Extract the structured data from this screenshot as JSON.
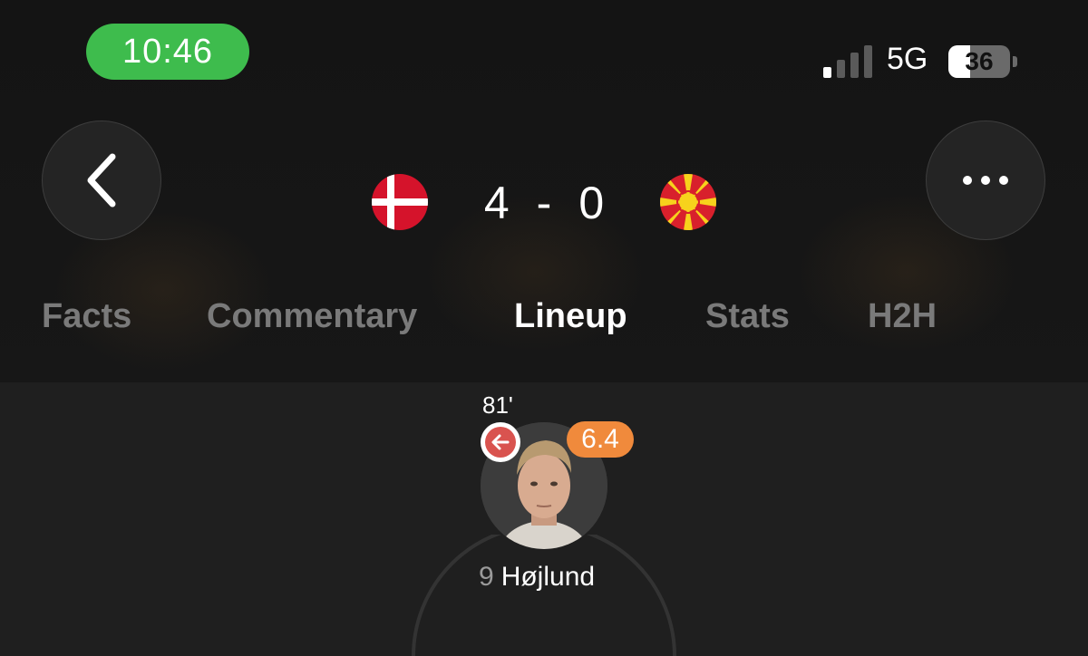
{
  "status_bar": {
    "time": "10:46",
    "network": "5G",
    "battery": "36",
    "signal_bars_active": 1,
    "signal_bars_total": 4
  },
  "header": {
    "back_icon": "chevron-left-icon",
    "more_icon": "ellipsis-icon",
    "home_flag": "denmark-flag-icon",
    "away_flag": "north-macedonia-flag-icon",
    "home_score": "4",
    "separator": "-",
    "away_score": "0"
  },
  "tabs": [
    {
      "label": "Facts",
      "active": false
    },
    {
      "label": "Commentary",
      "active": false
    },
    {
      "label": "Lineup",
      "active": true
    },
    {
      "label": "Stats",
      "active": false
    },
    {
      "label": "H2H",
      "active": false
    }
  ],
  "player": {
    "sub_minute": "81'",
    "rating": "6.4",
    "number": "9",
    "name": "Højlund",
    "sub_icon": "substitution-out-icon"
  },
  "colors": {
    "time_pill": "#3ebc4d",
    "rating_badge": "#f08a3c",
    "sub_out": "#d9534f",
    "active_tab": "#ffffff",
    "inactive_tab": "#7a7a7a"
  }
}
